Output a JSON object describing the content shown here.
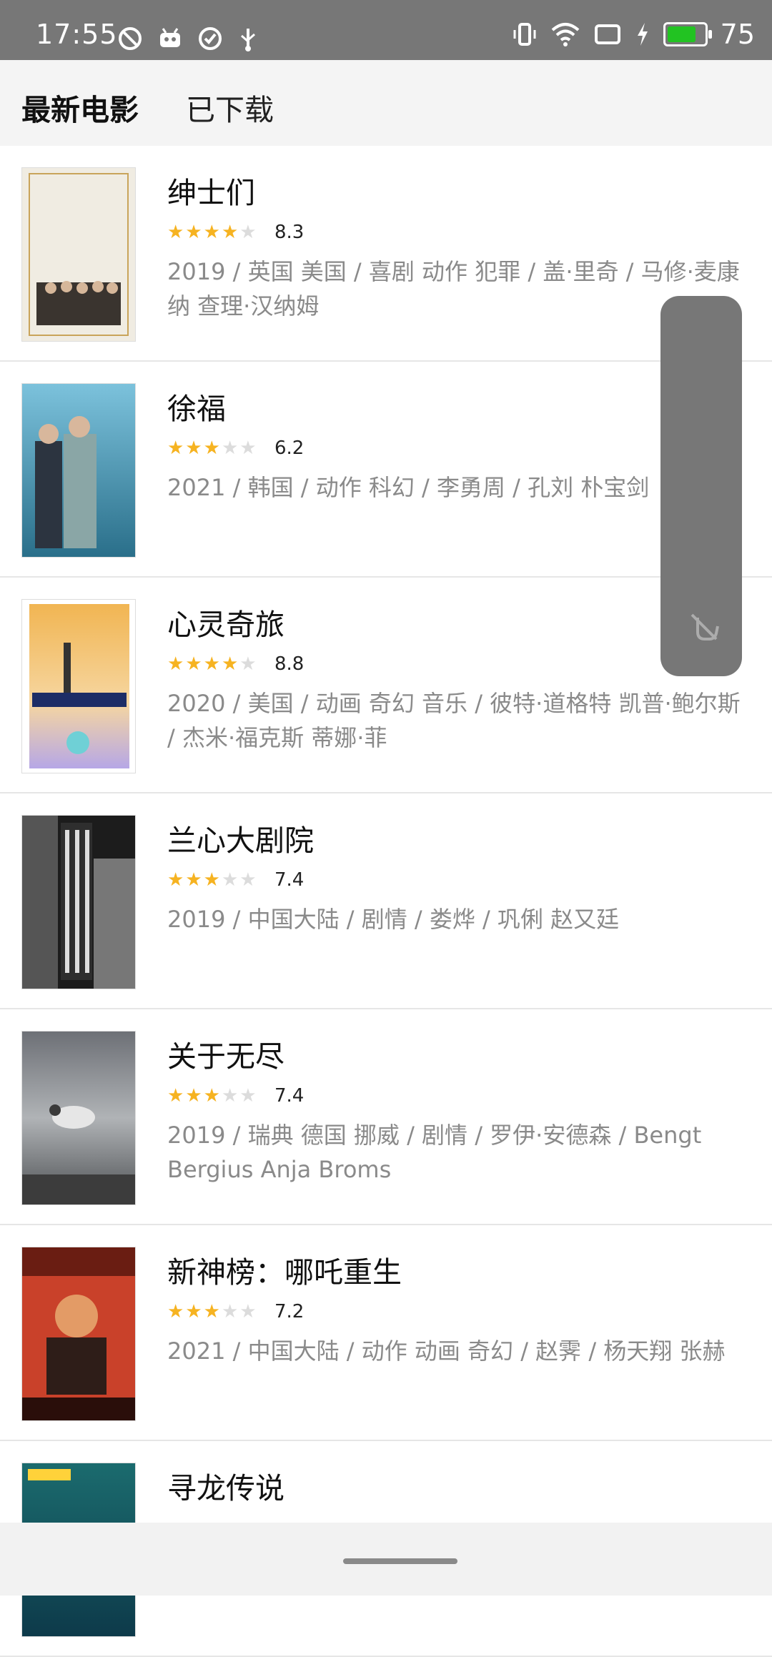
{
  "status_bar": {
    "time": "17:55",
    "left_icons": [
      "do-not-disturb-icon",
      "android-icon",
      "check-circle-icon",
      "usb-icon"
    ],
    "right_icons": [
      "vibrate-icon",
      "wifi-icon",
      "cast-icon",
      "charging-bolt-icon",
      "battery-icon"
    ],
    "battery_level": "75",
    "battery_fill_fraction": 0.9,
    "battery_color": "#22c322"
  },
  "tabs": [
    {
      "label": "最新电影",
      "active": true
    },
    {
      "label": "已下载",
      "active": false
    }
  ],
  "movies": [
    {
      "title": "绅士们",
      "rating": "8.3",
      "stars": 4,
      "meta": "2019 / 英国 美国 / 喜剧 动作 犯罪 / 盖·里奇 / 马修·麦康纳 查理·汉纳姆"
    },
    {
      "title": "徐福",
      "rating": "6.2",
      "stars": 3,
      "meta": "2021 / 韩国 / 动作 科幻 / 李勇周 / 孔刘 朴宝剑"
    },
    {
      "title": "心灵奇旅",
      "rating": "8.8",
      "stars": 4,
      "meta": "2020 / 美国 / 动画 奇幻 音乐 / 彼特·道格特 凯普·鲍尔斯 / 杰米·福克斯 蒂娜·菲"
    },
    {
      "title": "兰心大剧院",
      "rating": "7.4",
      "stars": 3,
      "meta": "2019 / 中国大陆 / 剧情 / 娄烨 / 巩俐 赵又廷"
    },
    {
      "title": "关于无尽",
      "rating": "7.4",
      "stars": 3,
      "meta": "2019 / 瑞典 德国 挪威 / 剧情 / 罗伊·安德森 / Bengt Bergius Anja Broms"
    },
    {
      "title": "新神榜：哪吒重生",
      "rating": "7.2",
      "stars": 3,
      "meta": "2021 / 中国大陆 / 动作 动画 奇幻 / 赵霁 / 杨天翔 张赫"
    },
    {
      "title": "寻龙传说",
      "rating": "",
      "stars": 0,
      "meta": ""
    }
  ],
  "floating_panel": {
    "icon": "no-touch-icon"
  },
  "colors": {
    "star": "#f6b321",
    "status_bar": "#777777",
    "meta_text": "#8a8a8a"
  }
}
